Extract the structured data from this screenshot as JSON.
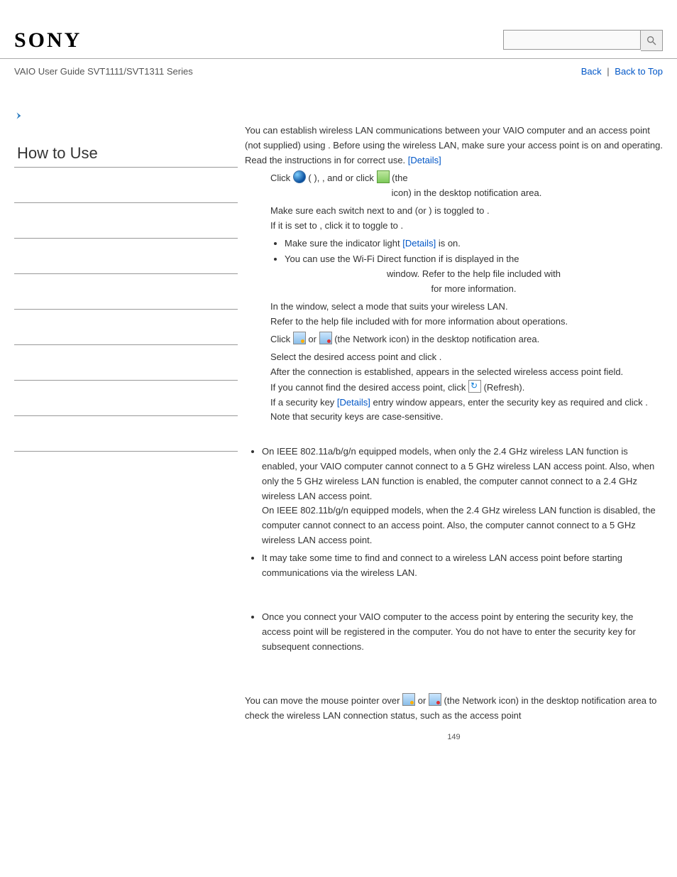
{
  "header": {
    "logo": "SONY",
    "search_placeholder": ""
  },
  "subhead": {
    "guide": "VAIO User Guide SVT1111/SVT1311 Series",
    "back": "Back",
    "back_to_top": "Back to Top"
  },
  "sidebar": {
    "title": "How to Use"
  },
  "intro": {
    "p1a": "You can establish wireless LAN communications between your VAIO computer and an access point (not supplied) using ",
    "p1b": ". Before using the wireless LAN, make sure your access point is on and operating.",
    "p2a": "Read the instructions in ",
    "p2b": " for correct use. ",
    "details": "[Details]"
  },
  "step1": {
    "a": "Click ",
    "b": " (",
    "c": "), ",
    "d": ", and ",
    "e": " or click ",
    "f": " (the",
    "g": " icon) in the desktop notification area."
  },
  "step2": {
    "a": "Make sure each switch next to ",
    "b": " and ",
    "c": " (or ",
    "d": ") is toggled to ",
    "e": ".",
    "f": "If it is set to ",
    "g": ", click it to toggle to ",
    "h": "."
  },
  "step2_sub1": {
    "a": "Make sure the ",
    "b": " indicator light ",
    "details": "[Details]",
    "c": " is on."
  },
  "step2_sub2": {
    "a": "You can use the Wi-Fi Direct function if ",
    "b": " is displayed in the ",
    "c": " window. Refer to the help file included with ",
    "d": " for more information."
  },
  "step3": {
    "a": "In the ",
    "b": " window, select a mode that suits your wireless LAN.",
    "c": "Refer to the help file included with ",
    "d": " for more information about operations."
  },
  "step4": {
    "a": "Click ",
    "b": " or ",
    "c": " (the Network icon) in the desktop notification area."
  },
  "step5": {
    "a": "Select the desired access point and click ",
    "b": ".",
    "c": "After the connection is established, ",
    "d": " appears in the selected wireless access point field.",
    "e": "If you cannot find the desired access point, click ",
    "f": " (Refresh).",
    "g": "If a security key ",
    "details": "[Details]",
    "h": " entry window appears, enter the security key as required and click ",
    "i": ". Note that security keys are case-sensitive."
  },
  "note1": "On IEEE 802.11a/b/g/n equipped models, when only the 2.4 GHz wireless LAN function is enabled, your VAIO computer cannot connect to a 5 GHz wireless LAN access point. Also, when only the 5 GHz wireless LAN function is enabled, the computer cannot connect to a 2.4 GHz wireless LAN access point.",
  "note1b": "On IEEE 802.11b/g/n equipped models, when the 2.4 GHz wireless LAN function is disabled, the computer cannot connect to an access point. Also, the computer cannot connect to a 5 GHz wireless LAN access point.",
  "note2": "It may take some time to find and connect to a wireless LAN access point before starting communications via the wireless LAN.",
  "note3": "Once you connect your VAIO computer to the access point by entering the security key, the access point will be registered in the computer. You do not have to enter the security key for subsequent connections.",
  "status": {
    "a": "You can move the mouse pointer over ",
    "b": " or ",
    "c": " (the Network icon) in the desktop notification area to check the wireless LAN connection status, such as the access point"
  },
  "page_number": "149"
}
